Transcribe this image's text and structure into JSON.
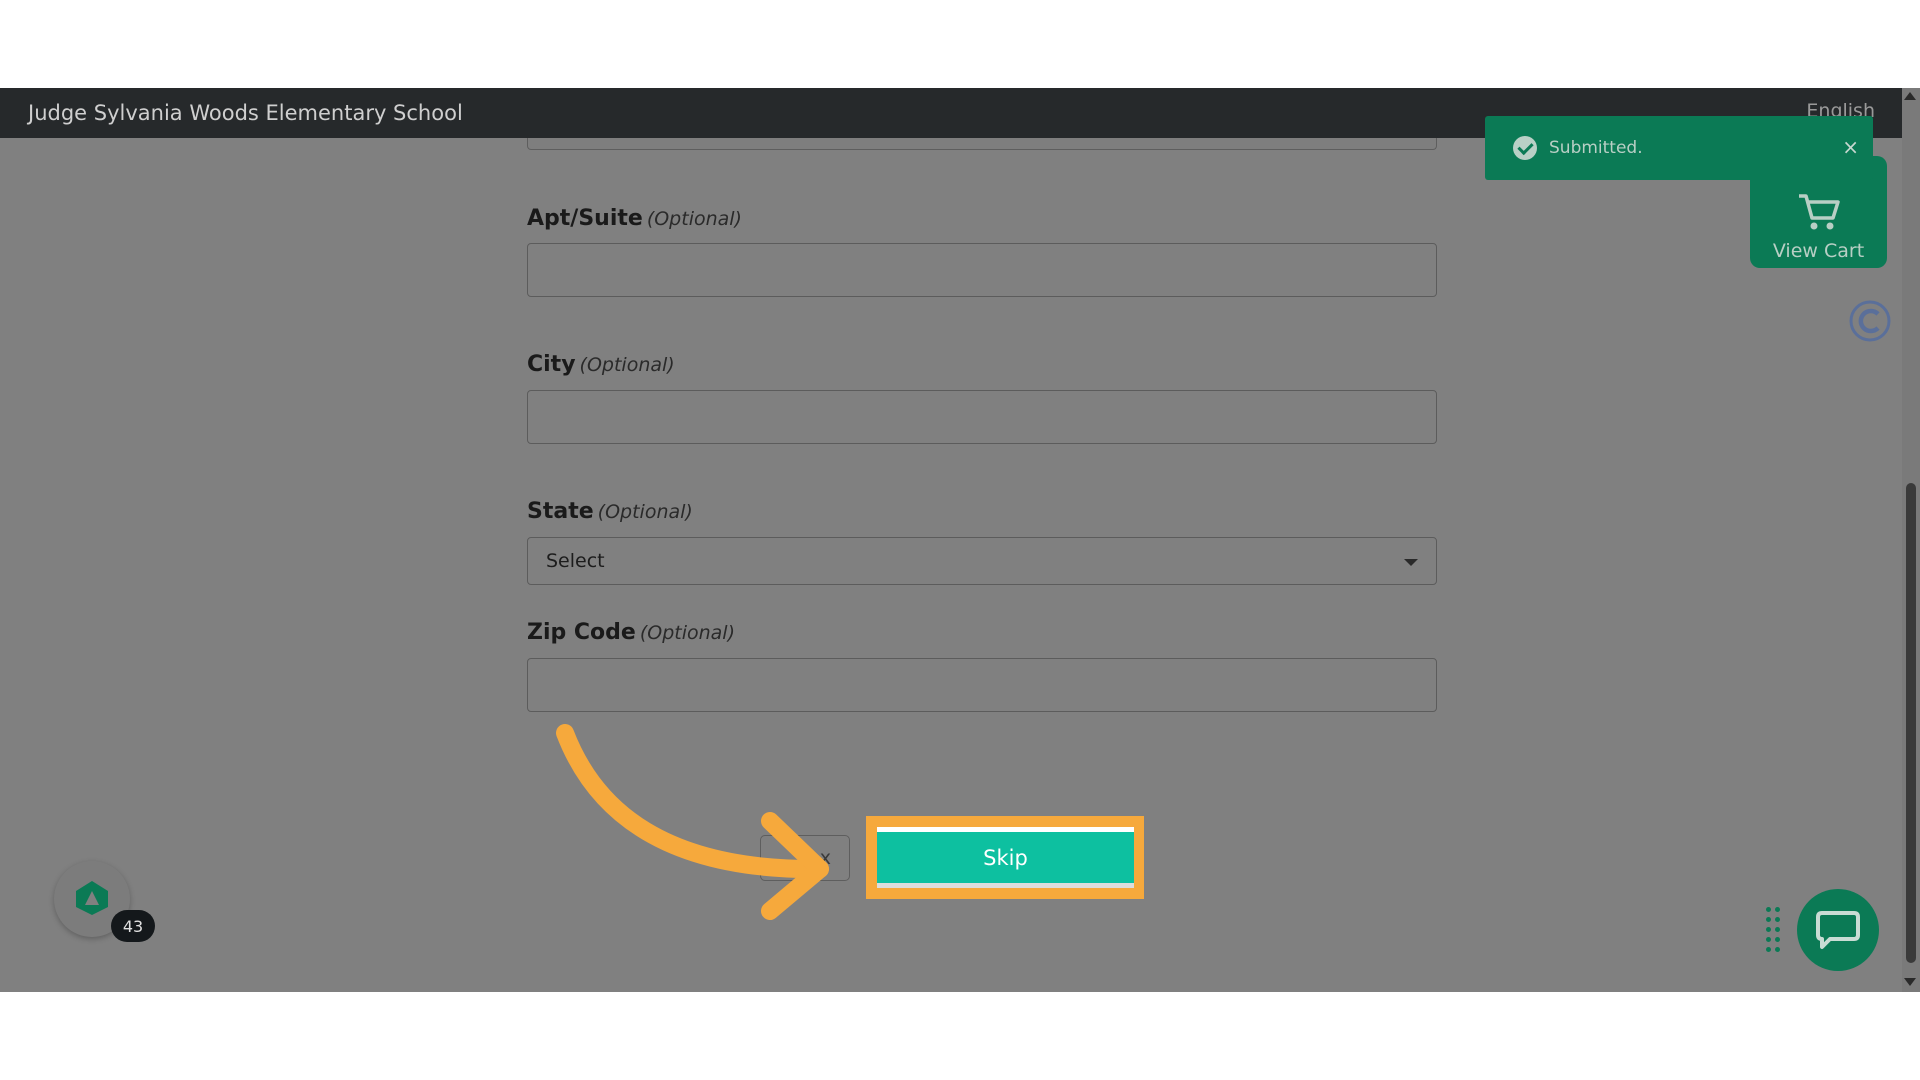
{
  "header": {
    "school_name": "Judge Sylvania Woods Elementary School",
    "language": "English"
  },
  "toast": {
    "message": "Submitted.",
    "close_symbol": "×",
    "icon": "check-circle-icon"
  },
  "cart": {
    "label": "View Cart",
    "icon": "cart-icon"
  },
  "form": {
    "apt": {
      "label": "Apt/Suite",
      "optional": "(Optional)",
      "value": ""
    },
    "city": {
      "label": "City",
      "optional": "(Optional)",
      "value": ""
    },
    "state": {
      "label": "State",
      "optional": "(Optional)",
      "selected": "Select"
    },
    "zip": {
      "label": "Zip Code",
      "optional": "(Optional)",
      "value": ""
    }
  },
  "buttons": {
    "cancel_partial": "x",
    "skip": "Skip"
  },
  "widget": {
    "count": "43"
  },
  "colors": {
    "brand_green": "#0b7a55",
    "skip_teal": "#0dc0a0",
    "highlight_orange": "#f6a93c"
  }
}
